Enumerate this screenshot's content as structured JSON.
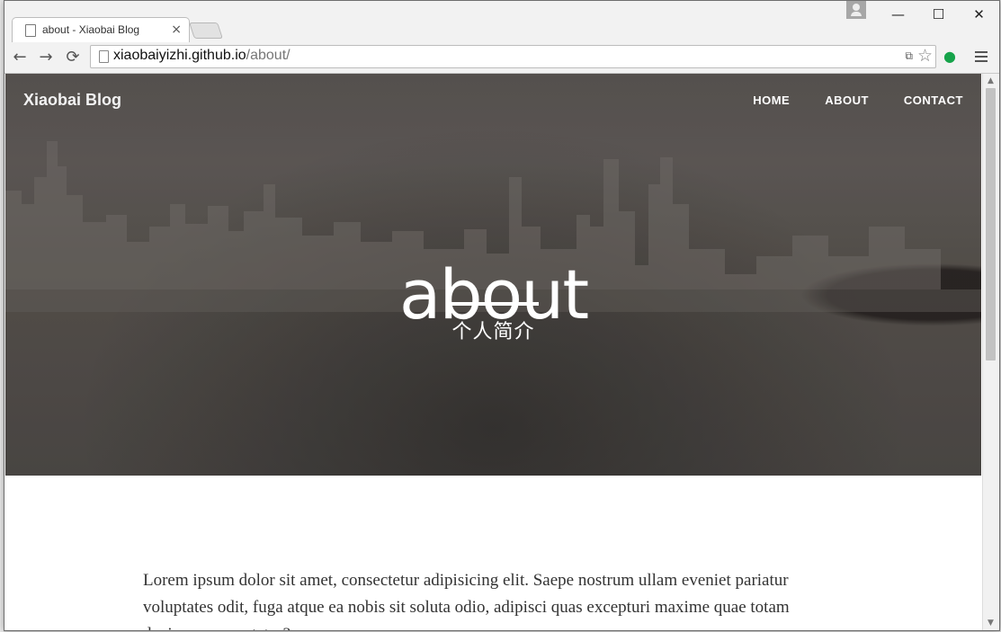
{
  "browser": {
    "tab_title": "about - Xiaobai Blog",
    "tab_close": "×",
    "url_host": "xiaobaiyizhi.github.io",
    "url_path": "/about/",
    "back": "←",
    "forward": "→",
    "reload": "⟳",
    "minimize": "—",
    "maximize": "☐",
    "close": "✕",
    "translate": "⧉",
    "bookmark": "☆",
    "extension": "●"
  },
  "site": {
    "brand": "Xiaobai Blog",
    "nav": [
      "HOME",
      "ABOUT",
      "CONTACT"
    ],
    "hero_title": "about",
    "hero_subtitle": "个人简介",
    "body_text": "Lorem ipsum dolor sit amet, consectetur adipisicing elit. Saepe nostrum ullam eveniet pariatur voluptates odit, fuga atque ea nobis sit soluta odio, adipisci quas excepturi maxime quae totam ducimus consectetur?"
  },
  "colors": {
    "hero_background": "#5c5754",
    "page_background": "#ffffff",
    "body_text": "#333333"
  }
}
